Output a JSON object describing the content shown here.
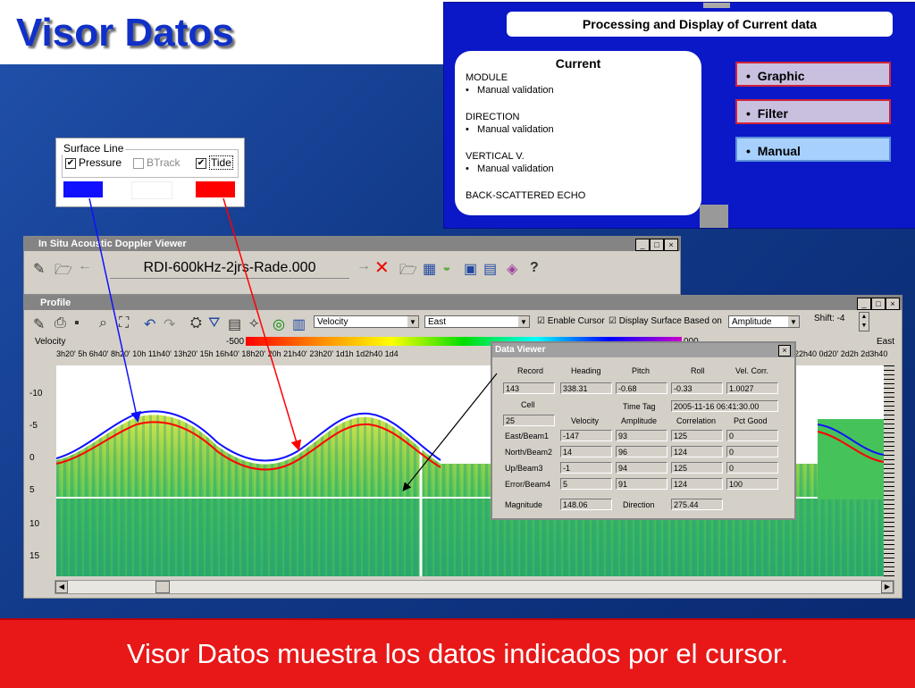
{
  "slide": {
    "title": "Visor Datos",
    "caption": "Visor Datos muestra los datos indicados por el cursor."
  },
  "diagram": {
    "title": "Processing and Display of Current data",
    "current": {
      "heading": "Current",
      "module": "MODULE",
      "module_item": "Manual validation",
      "direction": "DIRECTION",
      "direction_item": "Manual validation",
      "vertical": "VERTICAL V.",
      "vertical_item": "Manual validation",
      "echo": "BACK-SCATTERED ECHO"
    },
    "options": [
      "Graphic",
      "Filter",
      "Manual"
    ],
    "bullet": "•"
  },
  "surface_line": {
    "legend": "Surface Line",
    "checks": [
      {
        "label": "Pressure",
        "checked": true,
        "color": "#1010ff"
      },
      {
        "label": "BTrack",
        "checked": false,
        "color": "#ffffff"
      },
      {
        "label": "Tide",
        "checked": true,
        "color": "#ff0000"
      }
    ]
  },
  "main_window": {
    "title": "In Situ Acoustic Doppler Viewer",
    "file_name": "RDI-600kHz-2jrs-Rade.000",
    "buttons": {
      "min": "_",
      "max": "□",
      "close": "×"
    }
  },
  "profile_window": {
    "title": "Profile",
    "variable_select": "Velocity",
    "component_select": "East",
    "enable_cursor_label": "Enable Cursor",
    "display_surface_label": "Display Surface Based on",
    "surface_basis": "Amplitude",
    "shift_label": "Shift: -4",
    "plot_label_left": "Velocity",
    "plot_label_right": "East",
    "colorbar_min": "-500",
    "colorbar_max": "000",
    "time_ticks_left": "3h20'  5h    6h40'  8h20'  10h    11h40' 13h20' 15h    16h40' 18h20' 20h    21h40' 23h20' 1d1h  1d2h40 1d4",
    "time_ticks_right": "22h40 0d20'  2d2h  2d3h40'",
    "depth_ticks": [
      "-10",
      "-5",
      "0",
      "5",
      "10",
      "15"
    ]
  },
  "data_viewer": {
    "title": "Data Viewer",
    "headers_row1": [
      "Record",
      "Heading",
      "Pitch",
      "Roll",
      "Vel. Corr."
    ],
    "values_row1": [
      "143",
      "338.31",
      "-0.68",
      "-0.33",
      "1.0027"
    ],
    "cell_label": "Cell",
    "time_tag_label": "Time Tag",
    "time_tag": "2005-11-16 06:41:30.00",
    "cell_value": "25",
    "headers_row2": [
      "Velocity",
      "Amplitude",
      "Correlation",
      "Pct Good"
    ],
    "beams": [
      {
        "name": "East/Beam1",
        "velocity": "-147",
        "amplitude": "93",
        "correlation": "125",
        "pct_good": "0"
      },
      {
        "name": "North/Beam2",
        "velocity": "14",
        "amplitude": "96",
        "correlation": "124",
        "pct_good": "0"
      },
      {
        "name": "Up/Beam3",
        "velocity": "-1",
        "amplitude": "94",
        "correlation": "125",
        "pct_good": "0"
      },
      {
        "name": "Error/Beam4",
        "velocity": "5",
        "amplitude": "91",
        "correlation": "124",
        "pct_good": "100"
      }
    ],
    "magnitude_label": "Magnitude",
    "magnitude": "148.06",
    "direction_label": "Direction",
    "direction": "275.44"
  }
}
